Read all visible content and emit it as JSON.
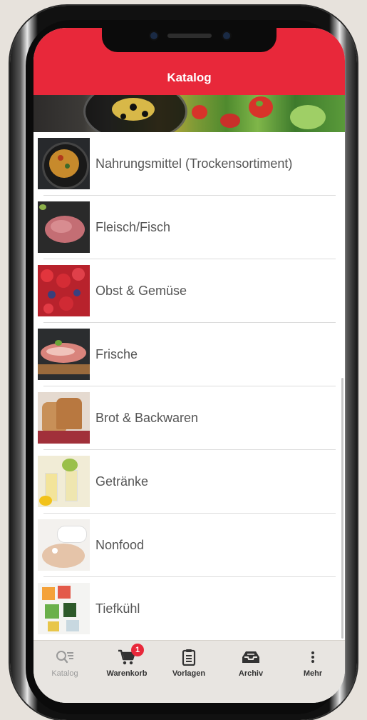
{
  "header": {
    "title": "Katalog"
  },
  "categories": [
    {
      "label": "Nahrungsmittel (Trockensortiment)",
      "image": "pasta-dish-image"
    },
    {
      "label": "Fleisch/Fisch",
      "image": "raw-meat-image"
    },
    {
      "label": "Obst & Gemüse",
      "image": "berries-image"
    },
    {
      "label": "Frische",
      "image": "prosciutto-image"
    },
    {
      "label": "Brot & Backwaren",
      "image": "bread-image"
    },
    {
      "label": "Getränke",
      "image": "drinks-image"
    },
    {
      "label": "Nonfood",
      "image": "pills-hand-image"
    },
    {
      "label": "Tiefkühl",
      "image": "frozen-food-image"
    }
  ],
  "tabbar": {
    "items": [
      {
        "label": "Katalog",
        "icon": "catalog-search-icon",
        "active": true
      },
      {
        "label": "Warenkorb",
        "icon": "cart-icon",
        "badge": "1"
      },
      {
        "label": "Vorlagen",
        "icon": "clipboard-icon"
      },
      {
        "label": "Archiv",
        "icon": "archive-tray-icon"
      },
      {
        "label": "Mehr",
        "icon": "more-vertical-icon"
      }
    ]
  },
  "colors": {
    "accent": "#e8283a",
    "tabbar_bg": "#e8e5e1",
    "active_tab": "#9a9a9a"
  }
}
